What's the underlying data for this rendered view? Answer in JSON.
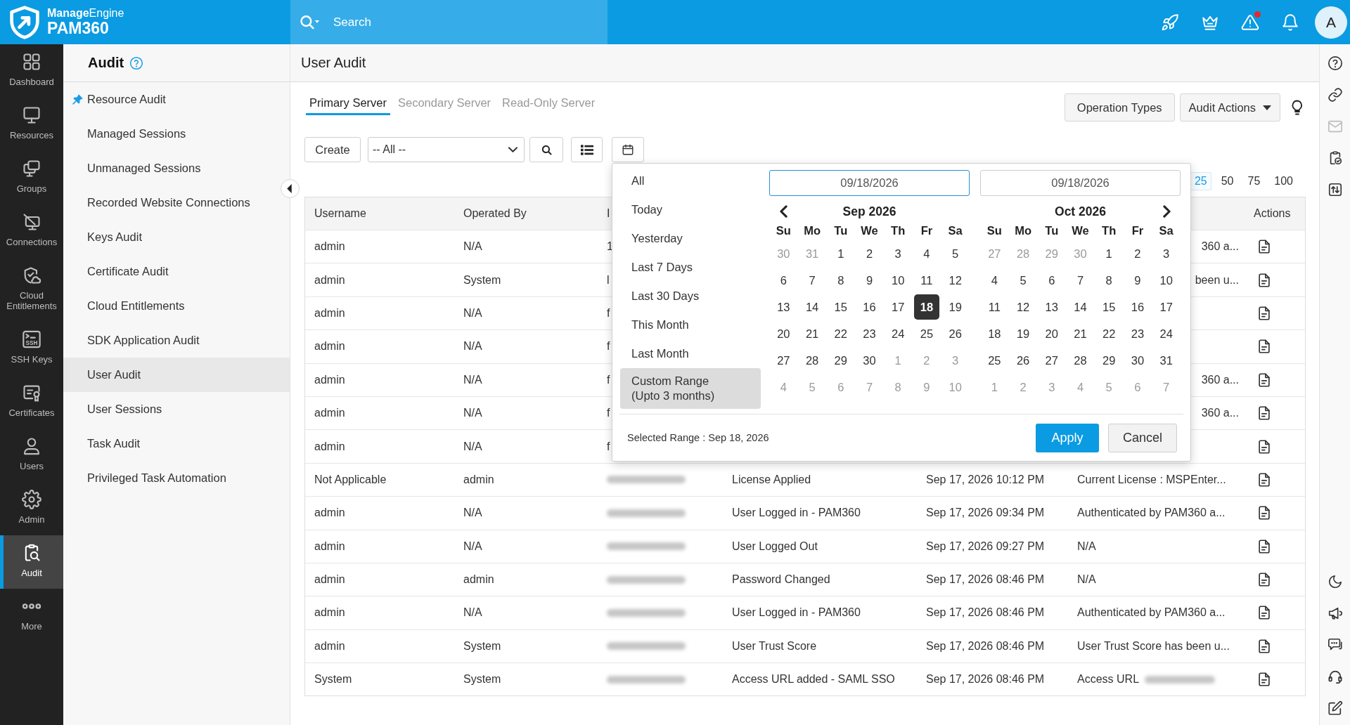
{
  "topbar": {
    "brand": {
      "maker": "**Manage**Engine",
      "product": "PAM360"
    },
    "search": {
      "placeholder": "Search"
    },
    "icons": [
      {
        "kind": "rocket",
        "dot": false
      },
      {
        "kind": "crown",
        "dot": false
      },
      {
        "kind": "alert",
        "dot": true
      },
      {
        "kind": "bell",
        "dot": false
      }
    ],
    "avatar": "A"
  },
  "nav": [
    {
      "label": "Dashboard",
      "kind": "dashboard",
      "selected": false
    },
    {
      "label": "Resources",
      "kind": "resources",
      "selected": false
    },
    {
      "label": "Groups",
      "kind": "groups",
      "selected": false
    },
    {
      "label": "Connections",
      "kind": "connections",
      "selected": false
    },
    {
      "label": "Cloud Entitlements",
      "kind": "cloud",
      "selected": false
    },
    {
      "label": "SSH Keys",
      "kind": "ssh",
      "icon_text": "SSH",
      "selected": false
    },
    {
      "label": "Certificates",
      "kind": "certificates",
      "selected": false
    },
    {
      "label": "Users",
      "kind": "users",
      "selected": false
    },
    {
      "label": "Admin",
      "kind": "admin",
      "selected": false
    },
    {
      "label": "Audit",
      "kind": "audit",
      "selected": true
    },
    {
      "label": "More",
      "kind": "more",
      "selected": false
    }
  ],
  "submenu": {
    "title": "Audit",
    "items": [
      {
        "label": "Resource Audit",
        "pinned": true,
        "selected": false
      },
      {
        "label": "Managed Sessions",
        "pinned": false,
        "selected": false
      },
      {
        "label": "Unmanaged Sessions",
        "pinned": false,
        "selected": false
      },
      {
        "label": "Recorded Website Connections",
        "pinned": false,
        "selected": false
      },
      {
        "label": "Keys Audit",
        "pinned": false,
        "selected": false
      },
      {
        "label": "Certificate Audit",
        "pinned": false,
        "selected": false
      },
      {
        "label": "Cloud Entitlements",
        "pinned": false,
        "selected": false
      },
      {
        "label": "SDK Application Audit",
        "pinned": false,
        "selected": false
      },
      {
        "label": "User Audit",
        "pinned": false,
        "selected": true
      },
      {
        "label": "User Sessions",
        "pinned": false,
        "selected": false
      },
      {
        "label": "Task Audit",
        "pinned": false,
        "selected": false
      },
      {
        "label": "Privileged Task Automation",
        "pinned": false,
        "selected": false
      }
    ]
  },
  "page": {
    "title": "User Audit"
  },
  "tabs": [
    {
      "label": "Primary Server",
      "selected": true
    },
    {
      "label": "Secondary Server",
      "selected": false
    },
    {
      "label": "Read-Only Server",
      "selected": false
    }
  ],
  "header_buttons": [
    {
      "label": "Operation Types",
      "kind": "plain"
    },
    {
      "label": "Audit Actions",
      "kind": "dropdown"
    }
  ],
  "toolbar": {
    "create": "Create",
    "filter": "-- All --"
  },
  "page_sizes": [
    {
      "label": "25",
      "selected": true
    },
    {
      "label": "50",
      "selected": false
    },
    {
      "label": "75",
      "selected": false
    },
    {
      "label": "100",
      "selected": false
    }
  ],
  "table": {
    "headings": {
      "username": "Username",
      "operated_by": "Operated By",
      "column_3": "I",
      "actions": "Actions"
    },
    "rows": [
      {
        "username": "admin",
        "operated_by": "N/A",
        "column_3": "1",
        "column_3_blurred": false,
        "column_6": "360 a...",
        "column_6_blurred": false
      },
      {
        "username": "admin",
        "operated_by": "System",
        "column_3": "l",
        "column_3_blurred": false,
        "column_6": "been u...",
        "column_6_blurred": false
      },
      {
        "username": "admin",
        "operated_by": "N/A",
        "column_3": "f",
        "column_3_blurred": false,
        "column_6_blurred": false
      },
      {
        "username": "admin",
        "operated_by": "N/A",
        "column_3": "f",
        "column_3_blurred": false,
        "column_6_blurred": false
      },
      {
        "username": "admin",
        "operated_by": "N/A",
        "column_3": "f",
        "column_3_blurred": false,
        "column_6": "360 a...",
        "column_6_blurred": false
      },
      {
        "username": "admin",
        "operated_by": "N/A",
        "column_3": "f",
        "column_3_blurred": false,
        "column_6": "360 a...",
        "column_6_blurred": false
      },
      {
        "username": "admin",
        "operated_by": "N/A",
        "column_3": "f",
        "column_3_blurred": false,
        "column_6_blurred": false
      },
      {
        "username": "Not Applicable",
        "operated_by": "admin",
        "column_3_blurred": true,
        "column_4": "License Applied",
        "column_5": "Sep 17, 2026 10:12 PM",
        "column_6": "Current License : MSPEnter...",
        "column_6_blurred": false
      },
      {
        "username": "admin",
        "operated_by": "N/A",
        "column_3_blurred": true,
        "column_4": "User Logged in - PAM360",
        "column_5": "Sep 17, 2026 09:34 PM",
        "column_6": "Authenticated by PAM360 a...",
        "column_6_blurred": false
      },
      {
        "username": "admin",
        "operated_by": "N/A",
        "column_3_blurred": true,
        "column_4": "User Logged Out",
        "column_5": "Sep 17, 2026 09:27 PM",
        "column_6": "N/A",
        "column_6_blurred": false
      },
      {
        "username": "admin",
        "operated_by": "admin",
        "column_3_blurred": true,
        "column_4": "Password Changed",
        "column_5": "Sep 17, 2026 08:46 PM",
        "column_6": "N/A",
        "column_6_blurred": false
      },
      {
        "username": "admin",
        "operated_by": "N/A",
        "column_3_blurred": true,
        "column_4": "User Logged in - PAM360",
        "column_5": "Sep 17, 2026 08:46 PM",
        "column_6": "Authenticated by PAM360 a...",
        "column_6_blurred": false
      },
      {
        "username": "admin",
        "operated_by": "System",
        "column_3_blurred": true,
        "column_4": "User Trust Score",
        "column_5": "Sep 17, 2026 08:46 PM",
        "column_6": "User Trust Score has been u...",
        "column_6_blurred": false
      },
      {
        "username": "System",
        "operated_by": "System",
        "column_3_blurred": true,
        "column_4": "Access URL added - SAML SSO",
        "column_5": "Sep 17, 2026 08:46 PM",
        "column_6": "Access URL",
        "column_6_blurred": true
      }
    ]
  },
  "date_picker": {
    "presets": [
      {
        "label": "All",
        "selected": false
      },
      {
        "label": "Today",
        "selected": false
      },
      {
        "label": "Yesterday",
        "selected": false
      },
      {
        "label": "Last 7 Days",
        "selected": false
      },
      {
        "label": "Last 30 Days",
        "selected": false
      },
      {
        "label": "This Month",
        "selected": false
      },
      {
        "label": "Last Month",
        "selected": false
      },
      {
        "label": "Custom Range (Upto 3 months)",
        "selected": true
      }
    ],
    "months": [
      {
        "field": {
          "value": "09/18/2026",
          "focused": true
        },
        "title": "Sep 2026",
        "weekdays": [
          "Su",
          "Mo",
          "Tu",
          "We",
          "Th",
          "Fr",
          "Sa"
        ],
        "weeks": [
          [
            {
              "day": "30",
              "outside": true,
              "selected": false
            },
            {
              "day": "31",
              "outside": true,
              "selected": false
            },
            {
              "day": "1",
              "outside": false,
              "selected": false
            },
            {
              "day": "2",
              "outside": false,
              "selected": false
            },
            {
              "day": "3",
              "outside": false,
              "selected": false
            },
            {
              "day": "4",
              "outside": false,
              "selected": false
            },
            {
              "day": "5",
              "outside": false,
              "selected": false
            }
          ],
          [
            {
              "day": "6",
              "outside": false,
              "selected": false
            },
            {
              "day": "7",
              "outside": false,
              "selected": false
            },
            {
              "day": "8",
              "outside": false,
              "selected": false
            },
            {
              "day": "9",
              "outside": false,
              "selected": false
            },
            {
              "day": "10",
              "outside": false,
              "selected": false
            },
            {
              "day": "11",
              "outside": false,
              "selected": false
            },
            {
              "day": "12",
              "outside": false,
              "selected": false
            }
          ],
          [
            {
              "day": "13",
              "outside": false,
              "selected": false
            },
            {
              "day": "14",
              "outside": false,
              "selected": false
            },
            {
              "day": "15",
              "outside": false,
              "selected": false
            },
            {
              "day": "16",
              "outside": false,
              "selected": false
            },
            {
              "day": "17",
              "outside": false,
              "selected": false
            },
            {
              "day": "18",
              "outside": false,
              "selected": true
            },
            {
              "day": "19",
              "outside": false,
              "selected": false
            }
          ],
          [
            {
              "day": "20",
              "outside": false,
              "selected": false
            },
            {
              "day": "21",
              "outside": false,
              "selected": false
            },
            {
              "day": "22",
              "outside": false,
              "selected": false
            },
            {
              "day": "23",
              "outside": false,
              "selected": false
            },
            {
              "day": "24",
              "outside": false,
              "selected": false
            },
            {
              "day": "25",
              "outside": false,
              "selected": false
            },
            {
              "day": "26",
              "outside": false,
              "selected": false
            }
          ],
          [
            {
              "day": "27",
              "outside": false,
              "selected": false
            },
            {
              "day": "28",
              "outside": false,
              "selected": false
            },
            {
              "day": "29",
              "outside": false,
              "selected": false
            },
            {
              "day": "30",
              "outside": false,
              "selected": false
            },
            {
              "day": "1",
              "outside": true,
              "selected": false
            },
            {
              "day": "2",
              "outside": true,
              "selected": false
            },
            {
              "day": "3",
              "outside": true,
              "selected": false
            }
          ],
          [
            {
              "day": "4",
              "outside": true,
              "selected": false
            },
            {
              "day": "5",
              "outside": true,
              "selected": false
            },
            {
              "day": "6",
              "outside": true,
              "selected": false
            },
            {
              "day": "7",
              "outside": true,
              "selected": false
            },
            {
              "day": "8",
              "outside": true,
              "selected": false
            },
            {
              "day": "9",
              "outside": true,
              "selected": false
            },
            {
              "day": "10",
              "outside": true,
              "selected": false
            }
          ]
        ]
      },
      {
        "field": {
          "value": "09/18/2026",
          "focused": false
        },
        "title": "Oct 2026",
        "weekdays": [
          "Su",
          "Mo",
          "Tu",
          "We",
          "Th",
          "Fr",
          "Sa"
        ],
        "weeks": [
          [
            {
              "day": "27",
              "outside": true,
              "selected": false
            },
            {
              "day": "28",
              "outside": true,
              "selected": false
            },
            {
              "day": "29",
              "outside": true,
              "selected": false
            },
            {
              "day": "30",
              "outside": true,
              "selected": false
            },
            {
              "day": "1",
              "outside": false,
              "selected": false
            },
            {
              "day": "2",
              "outside": false,
              "selected": false
            },
            {
              "day": "3",
              "outside": false,
              "selected": false
            }
          ],
          [
            {
              "day": "4",
              "outside": false,
              "selected": false
            },
            {
              "day": "5",
              "outside": false,
              "selected": false
            },
            {
              "day": "6",
              "outside": false,
              "selected": false
            },
            {
              "day": "7",
              "outside": false,
              "selected": false
            },
            {
              "day": "8",
              "outside": false,
              "selected": false
            },
            {
              "day": "9",
              "outside": false,
              "selected": false
            },
            {
              "day": "10",
              "outside": false,
              "selected": false
            }
          ],
          [
            {
              "day": "11",
              "outside": false,
              "selected": false
            },
            {
              "day": "12",
              "outside": false,
              "selected": false
            },
            {
              "day": "13",
              "outside": false,
              "selected": false
            },
            {
              "day": "14",
              "outside": false,
              "selected": false
            },
            {
              "day": "15",
              "outside": false,
              "selected": false
            },
            {
              "day": "16",
              "outside": false,
              "selected": false
            },
            {
              "day": "17",
              "outside": false,
              "selected": false
            }
          ],
          [
            {
              "day": "18",
              "outside": false,
              "selected": false
            },
            {
              "day": "19",
              "outside": false,
              "selected": false
            },
            {
              "day": "20",
              "outside": false,
              "selected": false
            },
            {
              "day": "21",
              "outside": false,
              "selected": false
            },
            {
              "day": "22",
              "outside": false,
              "selected": false
            },
            {
              "day": "23",
              "outside": false,
              "selected": false
            },
            {
              "day": "24",
              "outside": false,
              "selected": false
            }
          ],
          [
            {
              "day": "25",
              "outside": false,
              "selected": false
            },
            {
              "day": "26",
              "outside": false,
              "selected": false
            },
            {
              "day": "27",
              "outside": false,
              "selected": false
            },
            {
              "day": "28",
              "outside": false,
              "selected": false
            },
            {
              "day": "29",
              "outside": false,
              "selected": false
            },
            {
              "day": "30",
              "outside": false,
              "selected": false
            },
            {
              "day": "31",
              "outside": false,
              "selected": false
            }
          ],
          [
            {
              "day": "1",
              "outside": true,
              "selected": false
            },
            {
              "day": "2",
              "outside": true,
              "selected": false
            },
            {
              "day": "3",
              "outside": true,
              "selected": false
            },
            {
              "day": "4",
              "outside": true,
              "selected": false
            },
            {
              "day": "5",
              "outside": true,
              "selected": false
            },
            {
              "day": "6",
              "outside": true,
              "selected": false
            },
            {
              "day": "7",
              "outside": true,
              "selected": false
            }
          ]
        ]
      }
    ],
    "selected_range": "Selected Range : Sep 18, 2026",
    "apply": "Apply",
    "cancel": "Cancel"
  },
  "right_rail": {
    "top": [
      {
        "kind": "help",
        "disabled": false
      },
      {
        "kind": "link",
        "disabled": false
      },
      {
        "kind": "mail",
        "disabled": true
      },
      {
        "kind": "clipboard",
        "disabled": false
      },
      {
        "kind": "transfer",
        "disabled": false
      }
    ],
    "bottom": [
      {
        "kind": "moon"
      },
      {
        "kind": "megaphone"
      },
      {
        "kind": "chat"
      },
      {
        "kind": "headset"
      },
      {
        "kind": "edit"
      }
    ]
  }
}
